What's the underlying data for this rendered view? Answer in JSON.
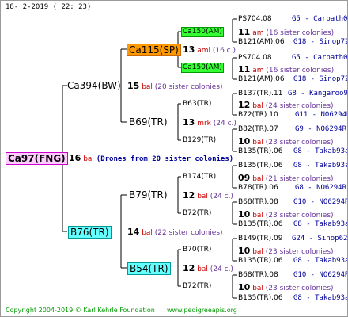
{
  "header": {
    "date": "18-  2-2019 ( 22: 23)"
  },
  "root": {
    "name": "Ca97(FNG)",
    "count": "16",
    "unit": "bal",
    "note": "(Drones from 20 sister colonies)"
  },
  "gen1": [
    {
      "name": "Ca394(BW)",
      "count": "15",
      "unit": "bal",
      "note": "(20 sister colonies)"
    },
    {
      "name": "B76(TR)",
      "count": "14",
      "unit": "bal",
      "note": "(22 sister colonies)"
    }
  ],
  "gen2": [
    {
      "name": "Ca115(SP)",
      "count": "13",
      "unit": "aml",
      "note": "(16 c.)"
    },
    {
      "name": "B69(TR)",
      "count": "13",
      "unit": "mrk",
      "note": "(24 c.)"
    },
    {
      "name": "B79(TR)",
      "count": "12",
      "unit": "bal",
      "note": "(24 c.)"
    },
    {
      "name": "B54(TR)",
      "count": "12",
      "unit": "bal",
      "note": "(24 c.)"
    }
  ],
  "gen3": [
    {
      "name": "Ca150(AM)",
      "count": "11",
      "unit": "am",
      "note": "(16 sister colonies)"
    },
    {
      "name": "Ca150(AM)",
      "count": "11",
      "unit": "am",
      "note": "(16 sister colonies)"
    },
    {
      "name": "B63(TR)",
      "count": "12",
      "unit": "bal",
      "note": "(24 sister colonies)"
    },
    {
      "name": "B129(TR)",
      "count": "10",
      "unit": "bal",
      "note": "(23 sister colonies)"
    },
    {
      "name": "B174(TR)",
      "count": "09",
      "unit": "bal",
      "note": "(21 sister colonies)"
    },
    {
      "name": "B72(TR)",
      "count": "10",
      "unit": "bal",
      "note": "(23 sister colonies)"
    },
    {
      "name": "B70(TR)",
      "count": "10",
      "unit": "bal",
      "note": "(23 sister colonies)"
    },
    {
      "name": "B72(TR)",
      "count": "10",
      "unit": "bal",
      "note": "(23 sister colonies)"
    }
  ],
  "gen4": [
    {
      "name": "PS704.08",
      "origin": "G5 - Carpath00R"
    },
    {
      "name": "B121(AM).06",
      "origin": "G18 - Sinop72R"
    },
    {
      "name": "PS704.08",
      "origin": "G5 - Carpath00R"
    },
    {
      "name": "B121(AM).06",
      "origin": "G18 - Sinop72R"
    },
    {
      "name": "B137(TR).11",
      "origin": "G8 - Kangaroo98R"
    },
    {
      "name": "B72(TR).10",
      "origin": "G11 - NO6294R"
    },
    {
      "name": "B82(TR).07",
      "origin": "G9 - NO6294R"
    },
    {
      "name": "B135(TR).06",
      "origin": "G8 - Takab93aR"
    },
    {
      "name": "B135(TR).06",
      "origin": "G8 - Takab93aR"
    },
    {
      "name": "B78(TR).06",
      "origin": "G8 - NO6294R"
    },
    {
      "name": "B68(TR).08",
      "origin": "G10 - NO6294R"
    },
    {
      "name": "B135(TR).06",
      "origin": "G8 - Takab93aR"
    },
    {
      "name": "B149(TR).09",
      "origin": "G24 - Sinop62R"
    },
    {
      "name": "B135(TR).06",
      "origin": "G8 - Takab93aR"
    },
    {
      "name": "B68(TR).08",
      "origin": "G10 - NO6294R"
    },
    {
      "name": "B135(TR).06",
      "origin": "G8 - Takab93aR"
    }
  ],
  "footer": {
    "copyright": "Copyright 2004-2019 © Karl Kehrle Foundation",
    "url": "www.pedigreeapis.org"
  }
}
